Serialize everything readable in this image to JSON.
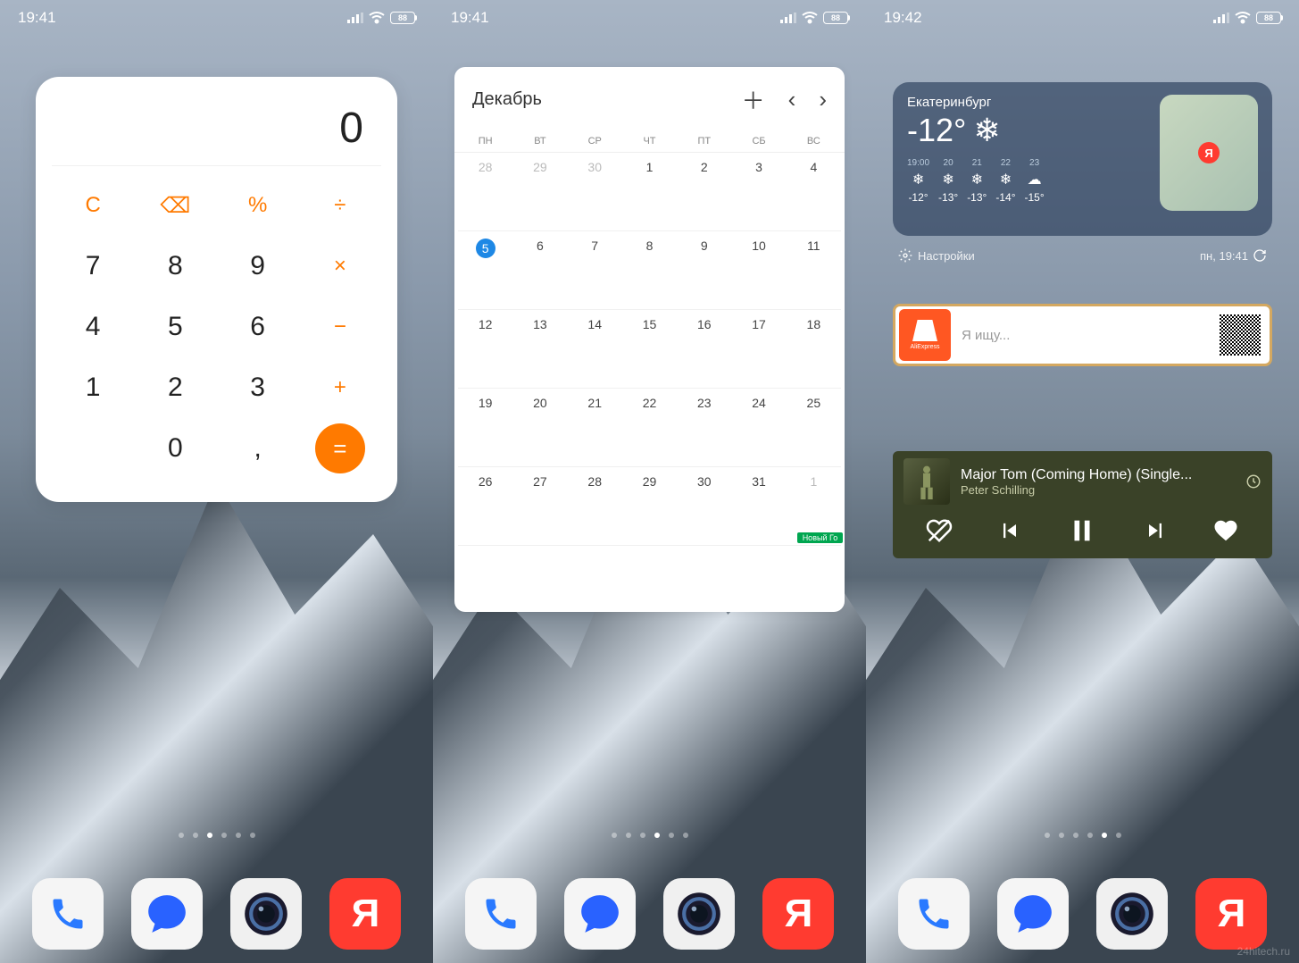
{
  "screens": [
    {
      "time": "19:41",
      "battery": "88",
      "active_page": 2
    },
    {
      "time": "19:41",
      "battery": "88",
      "active_page": 3
    },
    {
      "time": "19:42",
      "battery": "88",
      "active_page": 4
    }
  ],
  "page_dot_count": 6,
  "dock": {
    "apps": [
      "phone",
      "chat",
      "camera",
      "yandex"
    ],
    "yandex_letter": "Я"
  },
  "calculator": {
    "display": "0",
    "buttons": [
      {
        "label": "C",
        "type": "fn"
      },
      {
        "label": "⌫",
        "type": "fn"
      },
      {
        "label": "%",
        "type": "fn"
      },
      {
        "label": "÷",
        "type": "fn"
      },
      {
        "label": "7",
        "type": "num"
      },
      {
        "label": "8",
        "type": "num"
      },
      {
        "label": "9",
        "type": "num"
      },
      {
        "label": "×",
        "type": "fn"
      },
      {
        "label": "4",
        "type": "num"
      },
      {
        "label": "5",
        "type": "num"
      },
      {
        "label": "6",
        "type": "num"
      },
      {
        "label": "−",
        "type": "fn"
      },
      {
        "label": "1",
        "type": "num"
      },
      {
        "label": "2",
        "type": "num"
      },
      {
        "label": "3",
        "type": "num"
      },
      {
        "label": "+",
        "type": "fn"
      },
      {
        "label": "",
        "type": "blank"
      },
      {
        "label": "0",
        "type": "num"
      },
      {
        "label": ",",
        "type": "num"
      },
      {
        "label": "=",
        "type": "eq"
      }
    ]
  },
  "calendar": {
    "month": "Декабрь",
    "weekdays": [
      "ПН",
      "ВТ",
      "СР",
      "ЧТ",
      "ПТ",
      "СБ",
      "ВС"
    ],
    "days": [
      {
        "n": "28",
        "other": true
      },
      {
        "n": "29",
        "other": true
      },
      {
        "n": "30",
        "other": true
      },
      {
        "n": "1"
      },
      {
        "n": "2"
      },
      {
        "n": "3"
      },
      {
        "n": "4"
      },
      {
        "n": "5",
        "today": true
      },
      {
        "n": "6"
      },
      {
        "n": "7"
      },
      {
        "n": "8"
      },
      {
        "n": "9"
      },
      {
        "n": "10"
      },
      {
        "n": "11"
      },
      {
        "n": "12"
      },
      {
        "n": "13"
      },
      {
        "n": "14"
      },
      {
        "n": "15"
      },
      {
        "n": "16"
      },
      {
        "n": "17"
      },
      {
        "n": "18"
      },
      {
        "n": "19"
      },
      {
        "n": "20"
      },
      {
        "n": "21"
      },
      {
        "n": "22"
      },
      {
        "n": "23"
      },
      {
        "n": "24"
      },
      {
        "n": "25"
      },
      {
        "n": "26"
      },
      {
        "n": "27"
      },
      {
        "n": "28"
      },
      {
        "n": "29"
      },
      {
        "n": "30"
      },
      {
        "n": "31"
      },
      {
        "n": "1",
        "other": true,
        "event": "Новый Го"
      }
    ]
  },
  "weather": {
    "city": "Екатеринбург",
    "temp": "-12°",
    "icon": "❄",
    "hourly": [
      {
        "time": "19:00",
        "icon": "❄",
        "t": "-12°"
      },
      {
        "time": "20",
        "icon": "❄",
        "t": "-13°"
      },
      {
        "time": "21",
        "icon": "❄",
        "t": "-13°"
      },
      {
        "time": "22",
        "icon": "❄",
        "t": "-14°"
      },
      {
        "time": "23",
        "icon": "☁",
        "t": "-15°"
      }
    ],
    "settings_label": "Настройки",
    "timestamp": "пн, 19:41",
    "map_letter": "Я"
  },
  "aliexpress": {
    "logo_text": "AliExpress",
    "placeholder": "Я ищу..."
  },
  "music": {
    "title": "Major Tom (Coming Home) (Single...",
    "artist": "Peter Schilling"
  },
  "watermark": "24hitech.ru"
}
